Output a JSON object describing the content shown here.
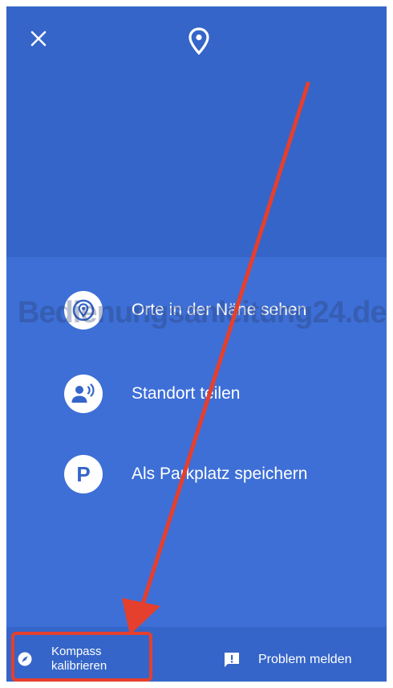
{
  "header": {
    "close_icon": "close-icon",
    "location_icon": "location-pin-icon"
  },
  "actions": [
    {
      "label": "Orte in der Nähe sehen",
      "icon": "nearby-places-icon"
    },
    {
      "label": "Standort teilen",
      "icon": "share-location-icon"
    },
    {
      "label": "Als Parkplatz speichern",
      "icon": "parking-icon",
      "glyph": "P"
    }
  ],
  "watermark": "Bedienungsanleitung24.de",
  "bottom_bar": {
    "kompass": {
      "line1": "Kompass",
      "line2": "kalibrieren",
      "icon": "compass-icon"
    },
    "problem": {
      "label": "Problem melden",
      "icon": "report-problem-icon"
    }
  },
  "colors": {
    "accent": "#3565c8",
    "panel": "#3e6fd6",
    "annotation": "#e53f2e"
  }
}
